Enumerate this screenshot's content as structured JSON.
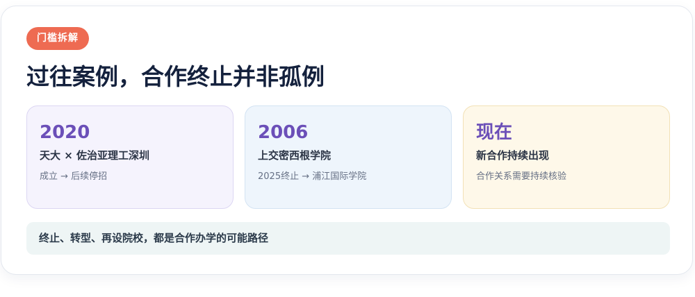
{
  "badge": "门槛拆解",
  "title": "过往案例，合作终止并非孤例",
  "cards": [
    {
      "year": "2020",
      "heading": "天大 × 佐治亚理工深圳",
      "sub": "成立 → 后续停招"
    },
    {
      "year": "2006",
      "heading": "上交密西根学院",
      "sub": "2025终止 → 浦江国际学院"
    },
    {
      "year": "现在",
      "heading": "新合作持续出现",
      "sub": "合作关系需要持续核验"
    }
  ],
  "footer": "终止、转型、再设院校，都是合作办学的可能路径",
  "colors": {
    "badge": "#ee6b52",
    "title": "#14213d",
    "year": "#6b4fb8",
    "card_1_bg": "#f5f3fd",
    "card_2_bg": "#eef5fc",
    "card_3_bg": "#fef8e9",
    "footer_bg": "#eef5f5"
  }
}
